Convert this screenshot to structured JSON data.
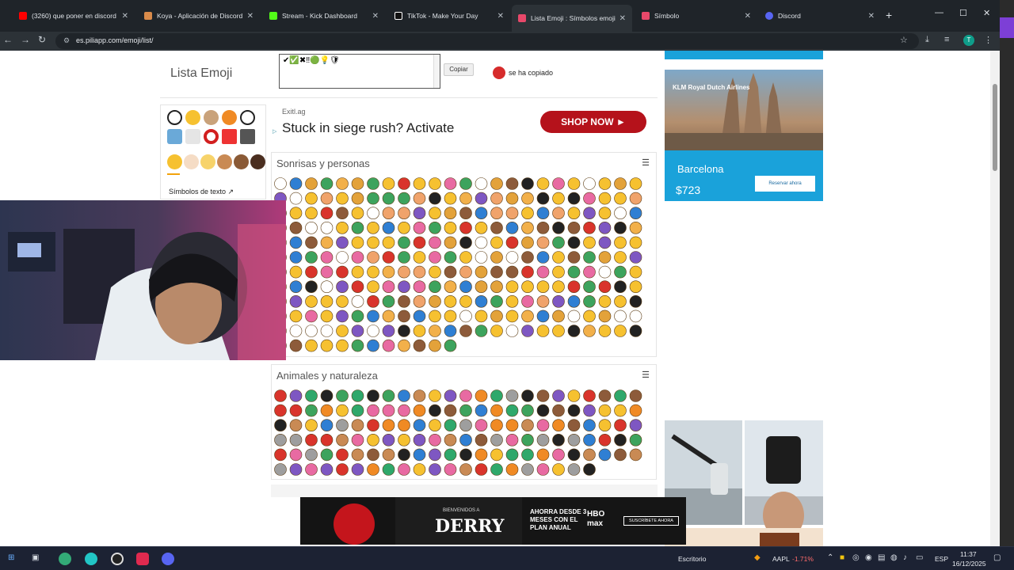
{
  "tabs": [
    {
      "title": "(3260) que poner en discord",
      "color": "#ff0000"
    },
    {
      "title": "Koya - Aplicación de Discord",
      "color": "#d98b4a"
    },
    {
      "title": "Stream - Kick Dashboard",
      "color": "#53fc18"
    },
    {
      "title": "TikTok - Make Your Day",
      "color": "#ffffff"
    },
    {
      "title": "Lista Emoji : Símbolos emoji",
      "color": "#e8486a"
    },
    {
      "title": "Símbolo",
      "color": "#e8486a"
    },
    {
      "title": "Discord",
      "color": "#5865f2"
    }
  ],
  "address": {
    "url": "es.piliapp.com/emoji/list/"
  },
  "site": {
    "title": "Lista Emoji",
    "copy_box_content": "✔✅✖‼🟢💡🛡",
    "copy_label": "Copiar",
    "copied_text": "se ha copiado"
  },
  "sidebar": {
    "text_symbols": "Símbolos de texto ↗"
  },
  "ad_top": {
    "brand": "Exitl.ag",
    "headline": "Stuck in siege rush? Activate",
    "cta": "SHOP NOW",
    "cta_arrow": "►"
  },
  "sections": [
    {
      "heading": "Sonrisas y personas",
      "menu_icon": "☰"
    },
    {
      "heading": "Animales y naturaleza",
      "menu_icon": "☰"
    }
  ],
  "ad_klm": {
    "brand": "KLM Royal Dutch Airlines",
    "city": "Barcelona",
    "price": "$723",
    "button": "Reservar ahora"
  },
  "ad_hbo": {
    "line1": "BIENVENIDOS A",
    "title": "DERRY",
    "offer": "AHORRA DESDE 3 MESES CON EL PLAN ANUAL",
    "logo": "HBO max",
    "cta": "SUSCRÍBETE AHORA"
  },
  "taskbar": {
    "desktop_label": "Escritorio",
    "ticker": "AAPL",
    "change": "-1.71%",
    "lang": "ESP",
    "time": "11:37",
    "date": "16/12/2025"
  },
  "colors": {
    "chrome_bg": "#1f2429",
    "toolbar_bg": "#2c3237",
    "emoji_yellow": "#f6c130",
    "shop_now_red": "#b5121b",
    "klm_blue": "#1aa2da",
    "taskbar_bg": "#1c2233"
  },
  "icons": {
    "back": "back-arrow-icon",
    "forward": "forward-arrow-icon",
    "reload": "reload-icon",
    "star": "bookmark-star-icon",
    "download": "download-icon",
    "extensions": "extensions-icon",
    "menu": "kebab-menu-icon"
  }
}
